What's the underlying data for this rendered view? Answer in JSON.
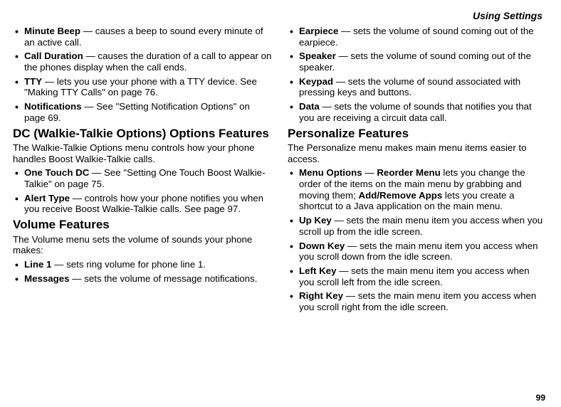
{
  "header": "Using Settings",
  "pageNumber": "99",
  "left": {
    "list1": [
      {
        "term": "Minute Beep",
        "desc": " — causes a beep to sound every minute of an active call."
      },
      {
        "term": "Call Duration",
        "desc": " — causes the duration of a call to appear on the phones display when the call ends."
      },
      {
        "term": "TTY",
        "desc": " — lets you use your phone with a TTY device. See \"Making TTY Calls\" on page 76."
      },
      {
        "term": "Notifications",
        "desc": " — See \"Setting Notification Options\" on page 69."
      }
    ],
    "h2a": "DC (Walkie-Talkie Options) Options Features",
    "introA": "The Walkie-Talkie Options menu controls how your phone handles Boost Walkie-Talkie calls.",
    "list2": [
      {
        "term": " One Touch DC",
        "desc": " — See \"Setting One Touch Boost Walkie-Talkie\" on page 75."
      },
      {
        "term": "Alert Type",
        "desc": " — controls how your phone notifies you when you receive Boost Walkie-Talkie calls. See page 97."
      }
    ],
    "h2b": "Volume Features",
    "introB": "The Volume menu sets the volume of sounds your phone makes:",
    "list3": [
      {
        "term": "Line 1",
        "desc": " — sets ring volume for phone line 1."
      },
      {
        "term": "Messages",
        "desc": " — sets the volume of message notifications."
      }
    ]
  },
  "right": {
    "list4": [
      {
        "term": "Earpiece",
        "desc": " — sets the volume of sound coming out of the earpiece."
      },
      {
        "term": "Speaker",
        "desc": " — sets the volume of sound coming out of the speaker."
      },
      {
        "term": "Keypad",
        "desc": " — sets the volume of sound associated with pressing keys and buttons."
      },
      {
        "term": "Data",
        "desc": " — sets the volume of sounds that notifies you that you are receiving a circuit data call."
      }
    ],
    "h2c": "Personalize Features",
    "introC": "The Personalize menu makes main menu items easier to access.",
    "list5": [
      {
        "term": "Menu Options",
        "pre": " — ",
        "inline1": "Reorder Menu",
        "mid": " lets you change the order of the items on the main menu by grabbing and moving them; ",
        "inline2": "Add/Remove Apps",
        "tail": " lets you create a shortcut to a Java application on the main menu."
      },
      {
        "term": "Up Key",
        "desc": " — sets the main menu item you access when you scroll up from the idle screen."
      },
      {
        "term": "Down Key",
        "desc": " — sets the main menu item you access when you scroll down from the idle screen."
      },
      {
        "term": "Left Key",
        "desc": " — sets the main menu item you access when you scroll left from the idle screen."
      },
      {
        "term": "Right Key",
        "desc": " — sets the main menu item you access when you scroll right from the idle screen."
      }
    ]
  }
}
